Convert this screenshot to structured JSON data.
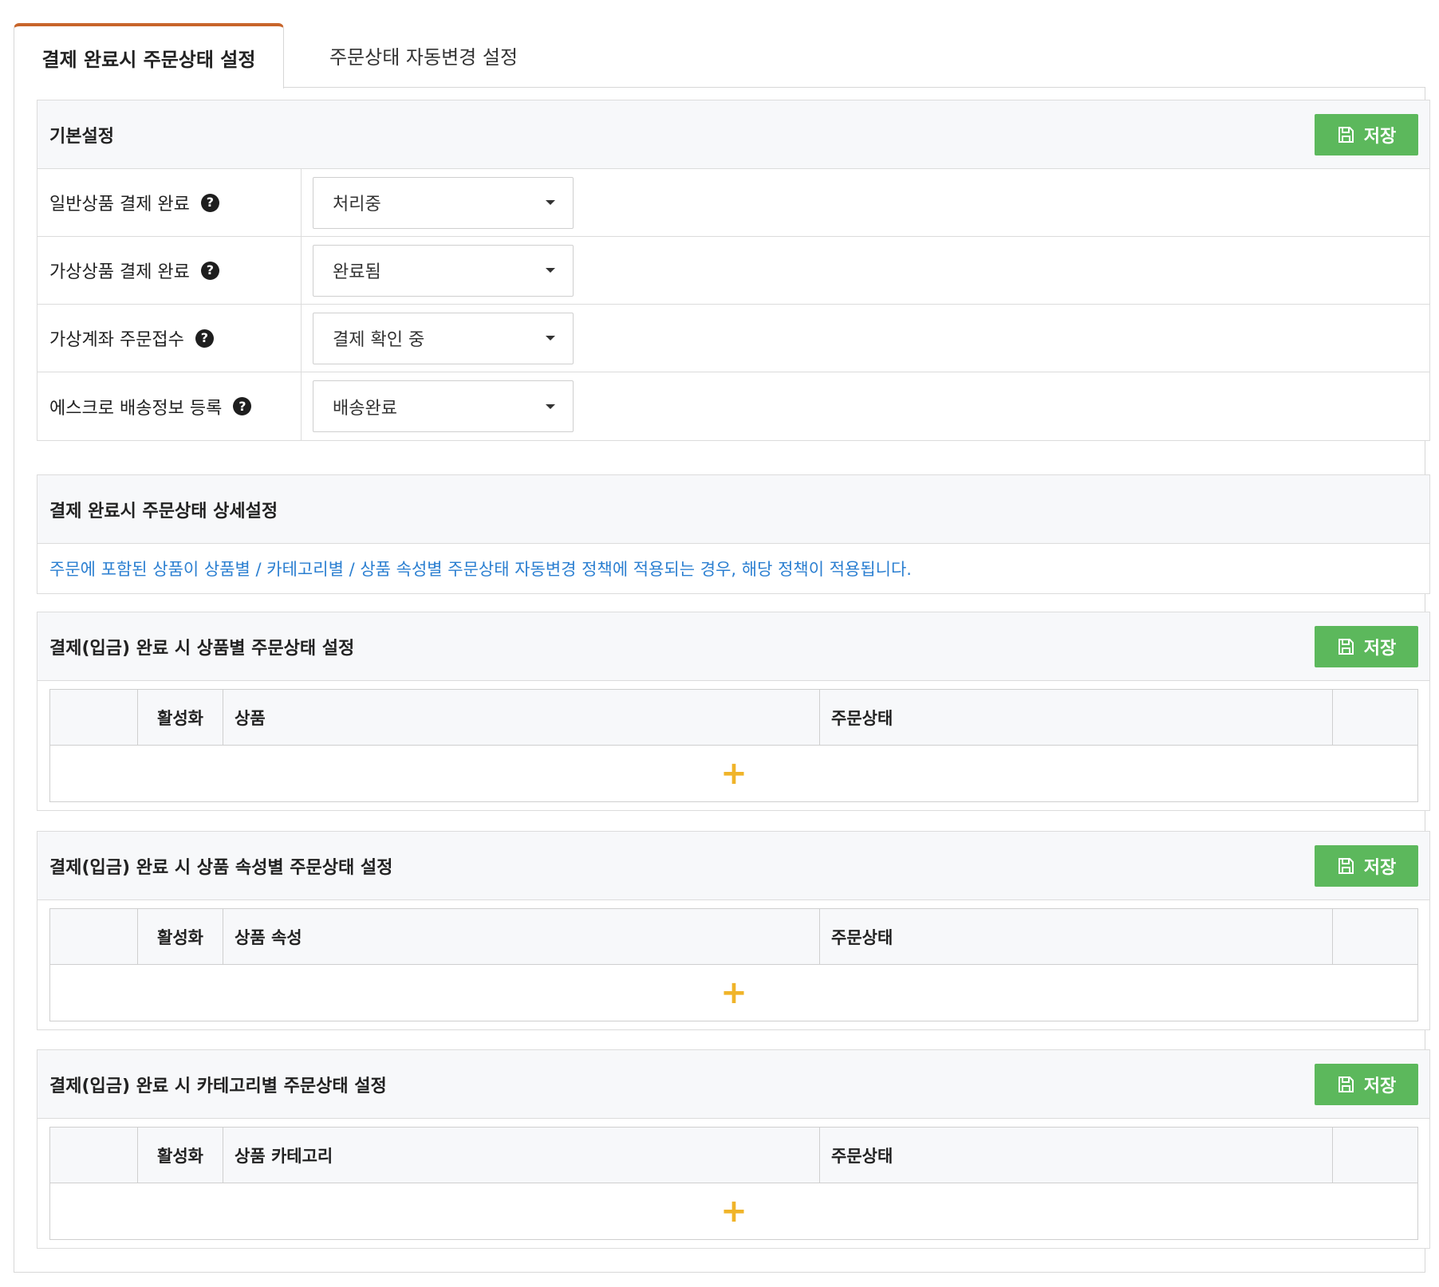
{
  "tabs": [
    {
      "label": "결제 완료시 주문상태 설정",
      "active": true
    },
    {
      "label": "주문상태 자동변경 설정",
      "active": false
    }
  ],
  "basic": {
    "title": "기본설정",
    "save_label": "저장",
    "rows": [
      {
        "label": "일반상품 결제 완료",
        "value": "처리중"
      },
      {
        "label": "가상상품 결제 완료",
        "value": "완료됨"
      },
      {
        "label": "가상계좌 주문접수",
        "value": "결제 확인 중"
      },
      {
        "label": "에스크로 배송정보 등록",
        "value": "배송완료"
      }
    ]
  },
  "detail": {
    "title": "결제 완료시 주문상태 상세설정",
    "notice": "주문에 포함된 상품이 상품별 / 카테고리별 / 상품 속성별 주문상태 자동변경 정책에 적용되는 경우, 해당 정책이 적용됩니다."
  },
  "product_section": {
    "title": "결제(입금) 완료 시 상품별 주문상태 설정",
    "save_label": "저장",
    "columns": [
      "",
      "활성화",
      "상품",
      "주문상태",
      ""
    ]
  },
  "attribute_section": {
    "title": "결제(입금) 완료 시 상품 속성별 주문상태 설정",
    "save_label": "저장",
    "columns": [
      "",
      "활성화",
      "상품 속성",
      "주문상태",
      ""
    ]
  },
  "category_section": {
    "title": "결제(입금) 완료 시 카테고리별 주문상태 설정",
    "save_label": "저장",
    "columns": [
      "",
      "활성화",
      "상품 카테고리",
      "주문상태",
      ""
    ]
  },
  "add_symbol": "+",
  "help_symbol": "?",
  "colors": {
    "tab_accent": "#c8652a",
    "save_button": "#5cb85c",
    "notice_text": "#2b7fd1",
    "add_icon": "#f0b429"
  },
  "icons": {
    "save": "floppy-disk-icon",
    "help": "question-circle-icon",
    "add": "plus-icon",
    "select": "caret-down-icon"
  }
}
